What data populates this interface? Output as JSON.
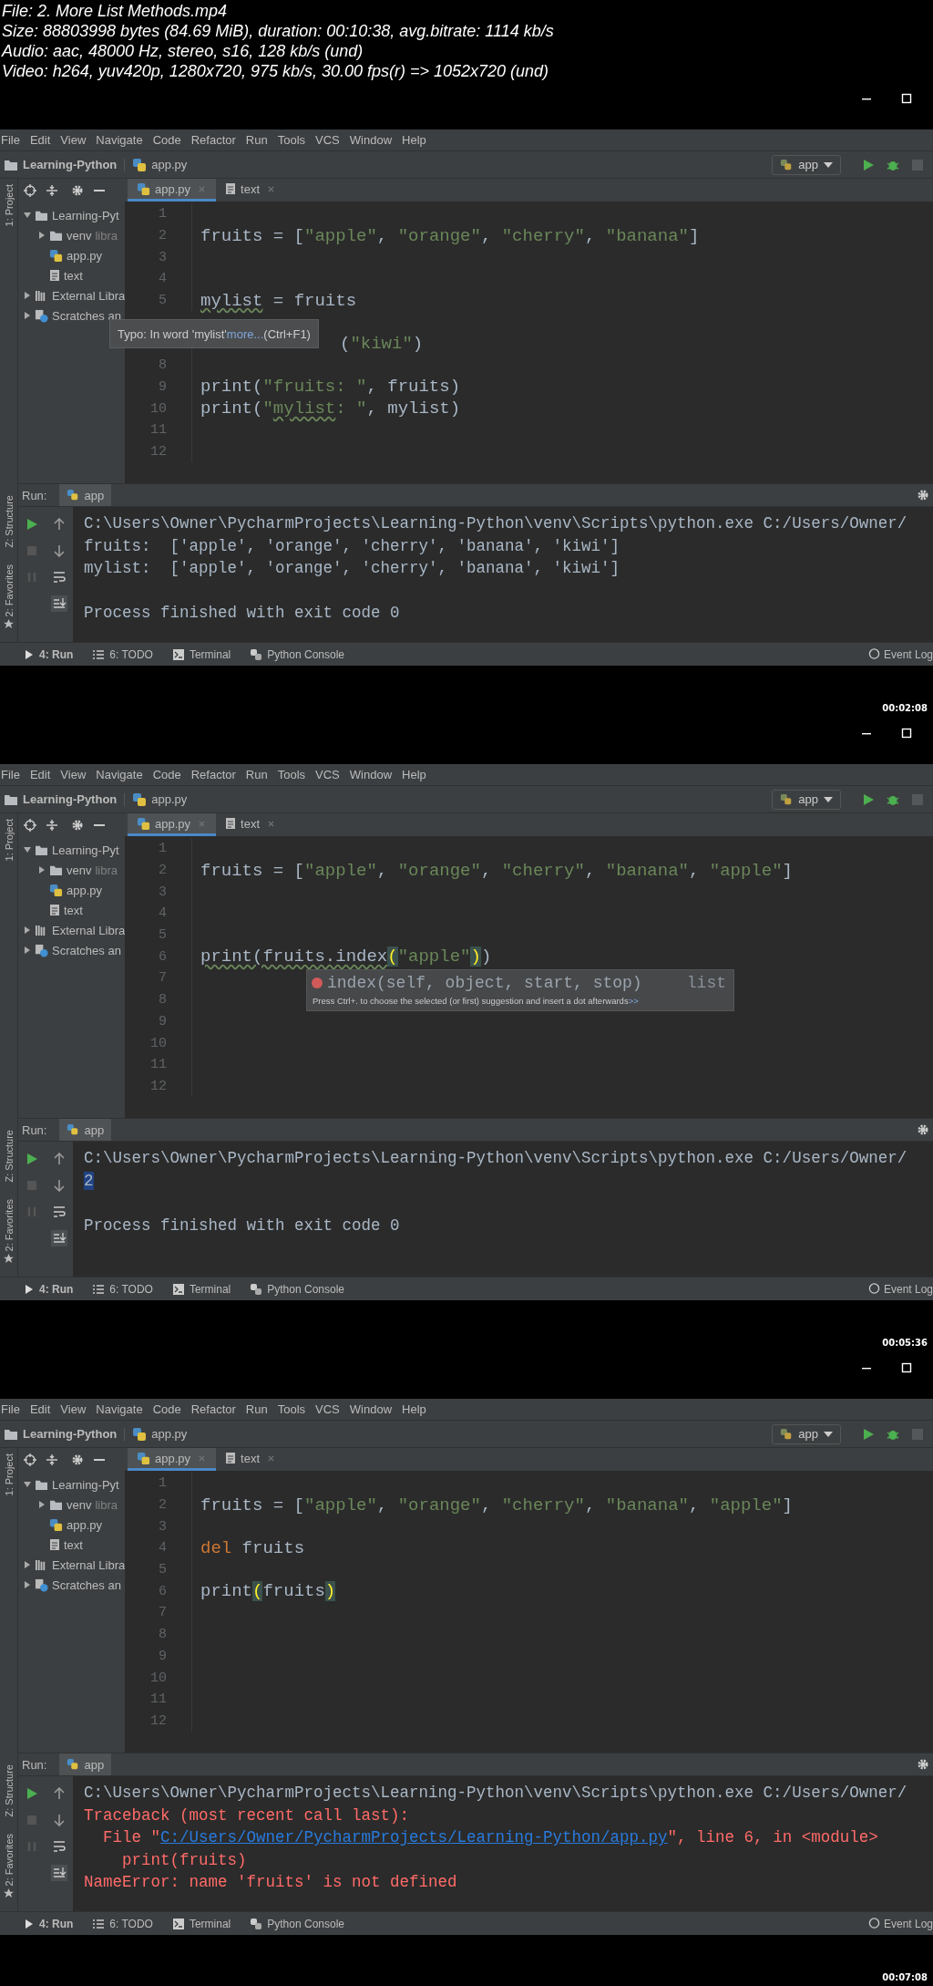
{
  "file_info": [
    "File: 2. More List Methods.mp4",
    "Size: 88803998 bytes (84.69 MiB), duration: 00:10:38, avg.bitrate: 1114 kb/s",
    "Audio: aac, 48000 Hz, stereo, s16, 128 kb/s (und)",
    "Video: h264, yuv420p, 1280x720, 975 kb/s, 30.00 fps(r) => 1052x720 (und)"
  ],
  "frames": [
    {
      "menu": [
        "File",
        "Edit",
        "View",
        "Navigate",
        "Code",
        "Refactor",
        "Run",
        "Tools",
        "VCS",
        "Window",
        "Help"
      ],
      "breadcrumb": {
        "project": "Learning-Python",
        "file": "app.py"
      },
      "run_config": "app",
      "side_tabs": [
        "1: Project",
        "Z: Structure",
        "2: Favorites"
      ],
      "tabs": [
        {
          "label": "app.py",
          "kind": "python",
          "selected": true
        },
        {
          "label": "text",
          "kind": "textfile",
          "selected": false
        }
      ],
      "tree": [
        {
          "label": "Learning-Pyt",
          "kind": "folder",
          "expanded": true,
          "children": [
            {
              "label": "venv",
              "note": "libra",
              "kind": "folder",
              "expanded": false
            },
            {
              "label": "app.py",
              "kind": "python"
            },
            {
              "label": "text",
              "kind": "textfile"
            }
          ]
        },
        {
          "label": "External Libra",
          "kind": "library",
          "expanded": false
        },
        {
          "label": "Scratches an",
          "kind": "scratch",
          "expanded": false
        }
      ],
      "editor": [
        {
          "number": "1"
        },
        {
          "number": "2",
          "tokens": [
            {
              "text": "fruits = [",
              "kind": "plain"
            },
            {
              "text": "\"apple\"",
              "kind": "string"
            },
            {
              "text": ", ",
              "kind": "plain"
            },
            {
              "text": "\"orange\"",
              "kind": "string"
            },
            {
              "text": ", ",
              "kind": "plain"
            },
            {
              "text": "\"cherry\"",
              "kind": "string"
            },
            {
              "text": ", ",
              "kind": "plain"
            },
            {
              "text": "\"banana\"",
              "kind": "string"
            },
            {
              "text": "]",
              "kind": "plain"
            }
          ]
        },
        {
          "number": "3"
        },
        {
          "number": "4"
        },
        {
          "number": "5",
          "tokens": [
            {
              "text": "mylist",
              "kind": "typo"
            },
            {
              "text": " = fruits",
              "kind": "plain"
            }
          ]
        },
        {
          "covered": true,
          "tokens": [
            {
              "text": "(",
              "kind": "plain"
            },
            {
              "text": "\"kiwi\"",
              "kind": "string"
            },
            {
              "text": ")",
              "kind": "plain"
            }
          ]
        },
        {
          "number": "8"
        },
        {
          "number": "9",
          "tokens": [
            {
              "text": "print(",
              "kind": "plain"
            },
            {
              "text": "\"fruits: \"",
              "kind": "string"
            },
            {
              "text": ", fruits)",
              "kind": "plain"
            }
          ]
        },
        {
          "number": "10",
          "tokens": [
            {
              "text": "print(",
              "kind": "plain"
            },
            {
              "text": "\"",
              "kind": "string"
            },
            {
              "text": "mylist",
              "kind": "typo-string"
            },
            {
              "text": ": \"",
              "kind": "string"
            },
            {
              "text": ", mylist)",
              "kind": "plain"
            }
          ]
        },
        {
          "number": "11"
        },
        {
          "number": "12"
        }
      ],
      "tooltip": {
        "text": "Typo: In word 'mylist'",
        "link": "more...",
        "shortcut": "(Ctrl+F1)"
      },
      "run": {
        "label": "Run:",
        "tab": "app",
        "console": [
          {
            "lines": [
              [
                {
                  "text": "C:\\Users\\Owner\\PycharmProjects\\Learning-Python\\venv\\Scripts\\python.exe C:/Users/Owner/",
                  "kind": "plain"
                }
              ],
              [
                {
                  "text": "fruits:  ['apple', 'orange', 'cherry', 'banana', 'kiwi']",
                  "kind": "plain"
                }
              ],
              [
                {
                  "text": "mylist:  ['apple', 'orange', 'cherry', 'banana', 'kiwi']",
                  "kind": "plain"
                }
              ]
            ]
          },
          {
            "lines": [
              [
                {
                  "text": "Process finished with exit code 0",
                  "kind": "plain"
                }
              ]
            ]
          }
        ]
      },
      "bottom_tabs": [
        {
          "label": "4: Run",
          "kind": "run"
        },
        {
          "label": "6: TODO",
          "kind": "todo"
        },
        {
          "label": "Terminal",
          "kind": "terminal"
        },
        {
          "label": "Python Console",
          "kind": "console"
        }
      ],
      "event_log": "Event Log",
      "timestamp": "00:02:08"
    },
    {
      "menu": [
        "File",
        "Edit",
        "View",
        "Navigate",
        "Code",
        "Refactor",
        "Run",
        "Tools",
        "VCS",
        "Window",
        "Help"
      ],
      "breadcrumb": {
        "project": "Learning-Python",
        "file": "app.py"
      },
      "run_config": "app",
      "side_tabs": [
        "1: Project",
        "Z: Structure",
        "2: Favorites"
      ],
      "tabs": [
        {
          "label": "app.py",
          "kind": "python",
          "selected": true
        },
        {
          "label": "text",
          "kind": "textfile",
          "selected": false
        }
      ],
      "tree": [
        {
          "label": "Learning-Pyt",
          "kind": "folder",
          "expanded": true,
          "children": [
            {
              "label": "venv",
              "note": "libra",
              "kind": "folder",
              "expanded": false
            },
            {
              "label": "app.py",
              "kind": "python"
            },
            {
              "label": "text",
              "kind": "textfile"
            }
          ]
        },
        {
          "label": "External Libra",
          "kind": "library",
          "expanded": false
        },
        {
          "label": "Scratches an",
          "kind": "scratch",
          "expanded": false
        }
      ],
      "editor": [
        {
          "number": "1"
        },
        {
          "number": "2",
          "tokens": [
            {
              "text": "fruits = [",
              "kind": "plain"
            },
            {
              "text": "\"apple\"",
              "kind": "string"
            },
            {
              "text": ", ",
              "kind": "plain"
            },
            {
              "text": "\"orange\"",
              "kind": "string"
            },
            {
              "text": ", ",
              "kind": "plain"
            },
            {
              "text": "\"cherry\"",
              "kind": "string"
            },
            {
              "text": ", ",
              "kind": "plain"
            },
            {
              "text": "\"banana\"",
              "kind": "string"
            },
            {
              "text": ", ",
              "kind": "plain"
            },
            {
              "text": "\"apple\"",
              "kind": "string"
            },
            {
              "text": "]",
              "kind": "plain"
            }
          ]
        },
        {
          "number": "3"
        },
        {
          "number": "4"
        },
        {
          "number": "5"
        },
        {
          "number": "6",
          "tokens": [
            {
              "text": "print(fruits.index",
              "kind": "typo"
            },
            {
              "text": "(",
              "kind": "match"
            },
            {
              "text": "\"apple\"",
              "kind": "string"
            },
            {
              "text": ")",
              "kind": "match"
            },
            {
              "text": ")",
              "kind": "plain"
            }
          ]
        },
        {
          "number": "7"
        },
        {
          "number": "8"
        },
        {
          "number": "9"
        },
        {
          "number": "10"
        },
        {
          "number": "11"
        },
        {
          "number": "12"
        }
      ],
      "popup": {
        "signature": "index(self, object, start, stop)",
        "type": "list",
        "hint": "Press Ctrl+. to choose the selected (or first) suggestion and insert a dot afterwards",
        "link": ">>"
      },
      "run": {
        "label": "Run:",
        "tab": "app",
        "console": [
          {
            "lines": [
              [
                {
                  "text": "C:\\Users\\Owner\\PycharmProjects\\Learning-Python\\venv\\Scripts\\python.exe C:/Users/Owner/",
                  "kind": "plain"
                }
              ],
              [
                {
                  "text": "2",
                  "kind": "selected"
                }
              ]
            ]
          },
          {
            "lines": [
              [
                {
                  "text": "Process finished with exit code 0",
                  "kind": "plain"
                }
              ]
            ]
          }
        ]
      },
      "bottom_tabs": [
        {
          "label": "4: Run",
          "kind": "run"
        },
        {
          "label": "6: TODO",
          "kind": "todo"
        },
        {
          "label": "Terminal",
          "kind": "terminal"
        },
        {
          "label": "Python Console",
          "kind": "console"
        }
      ],
      "event_log": "Event Log",
      "timestamp": "00:05:36"
    },
    {
      "menu": [
        "File",
        "Edit",
        "View",
        "Navigate",
        "Code",
        "Refactor",
        "Run",
        "Tools",
        "VCS",
        "Window",
        "Help"
      ],
      "breadcrumb": {
        "project": "Learning-Python",
        "file": "app.py"
      },
      "run_config": "app",
      "side_tabs": [
        "1: Project",
        "Z: Structure",
        "2: Favorites"
      ],
      "tabs": [
        {
          "label": "app.py",
          "kind": "python",
          "selected": true
        },
        {
          "label": "text",
          "kind": "textfile",
          "selected": false
        }
      ],
      "tree": [
        {
          "label": "Learning-Pyt",
          "kind": "folder",
          "expanded": true,
          "children": [
            {
              "label": "venv",
              "note": "libra",
              "kind": "folder",
              "expanded": false
            },
            {
              "label": "app.py",
              "kind": "python"
            },
            {
              "label": "text",
              "kind": "textfile"
            }
          ]
        },
        {
          "label": "External Libra",
          "kind": "library",
          "expanded": false
        },
        {
          "label": "Scratches an",
          "kind": "scratch",
          "expanded": false
        }
      ],
      "editor": [
        {
          "number": "1"
        },
        {
          "number": "2",
          "tokens": [
            {
              "text": "fruits = [",
              "kind": "plain"
            },
            {
              "text": "\"apple\"",
              "kind": "string"
            },
            {
              "text": ", ",
              "kind": "plain"
            },
            {
              "text": "\"orange\"",
              "kind": "string"
            },
            {
              "text": ", ",
              "kind": "plain"
            },
            {
              "text": "\"cherry\"",
              "kind": "string"
            },
            {
              "text": ", ",
              "kind": "plain"
            },
            {
              "text": "\"banana\"",
              "kind": "string"
            },
            {
              "text": ", ",
              "kind": "plain"
            },
            {
              "text": "\"apple\"",
              "kind": "string"
            },
            {
              "text": "]",
              "kind": "plain"
            }
          ]
        },
        {
          "number": "3"
        },
        {
          "number": "4",
          "tokens": [
            {
              "text": "del",
              "kind": "keyword"
            },
            {
              "text": " fruits",
              "kind": "plain"
            }
          ]
        },
        {
          "number": "5"
        },
        {
          "number": "6",
          "tokens": [
            {
              "text": "print",
              "kind": "plain"
            },
            {
              "text": "(",
              "kind": "match"
            },
            {
              "text": "fruits",
              "kind": "plain"
            },
            {
              "text": ")",
              "kind": "match"
            }
          ]
        },
        {
          "number": "7"
        },
        {
          "number": "8"
        },
        {
          "number": "9"
        },
        {
          "number": "10"
        },
        {
          "number": "11"
        },
        {
          "number": "12"
        }
      ],
      "run": {
        "label": "Run:",
        "tab": "app",
        "console": [
          {
            "lines": [
              [
                {
                  "text": "C:\\Users\\Owner\\PycharmProjects\\Learning-Python\\venv\\Scripts\\python.exe C:/Users/Owner/",
                  "kind": "plain"
                }
              ],
              [
                {
                  "text": "Traceback (most recent call last):",
                  "kind": "error"
                }
              ],
              [
                {
                  "text": "  File \"",
                  "kind": "error"
                },
                {
                  "text": "C:/Users/Owner/PycharmProjects/Learning-Python/app.py",
                  "kind": "link"
                },
                {
                  "text": "\", line 6, in <module>",
                  "kind": "error"
                }
              ],
              [
                {
                  "text": "    print(fruits)",
                  "kind": "error"
                }
              ],
              [
                {
                  "text": "NameError: name 'fruits' is not defined",
                  "kind": "error"
                }
              ]
            ]
          }
        ]
      },
      "bottom_tabs": [
        {
          "label": "4: Run",
          "kind": "run"
        },
        {
          "label": "6: TODO",
          "kind": "todo"
        },
        {
          "label": "Terminal",
          "kind": "terminal"
        },
        {
          "label": "Python Console",
          "kind": "console"
        }
      ],
      "event_log": "Event Log",
      "timestamp": "00:07:08"
    }
  ]
}
